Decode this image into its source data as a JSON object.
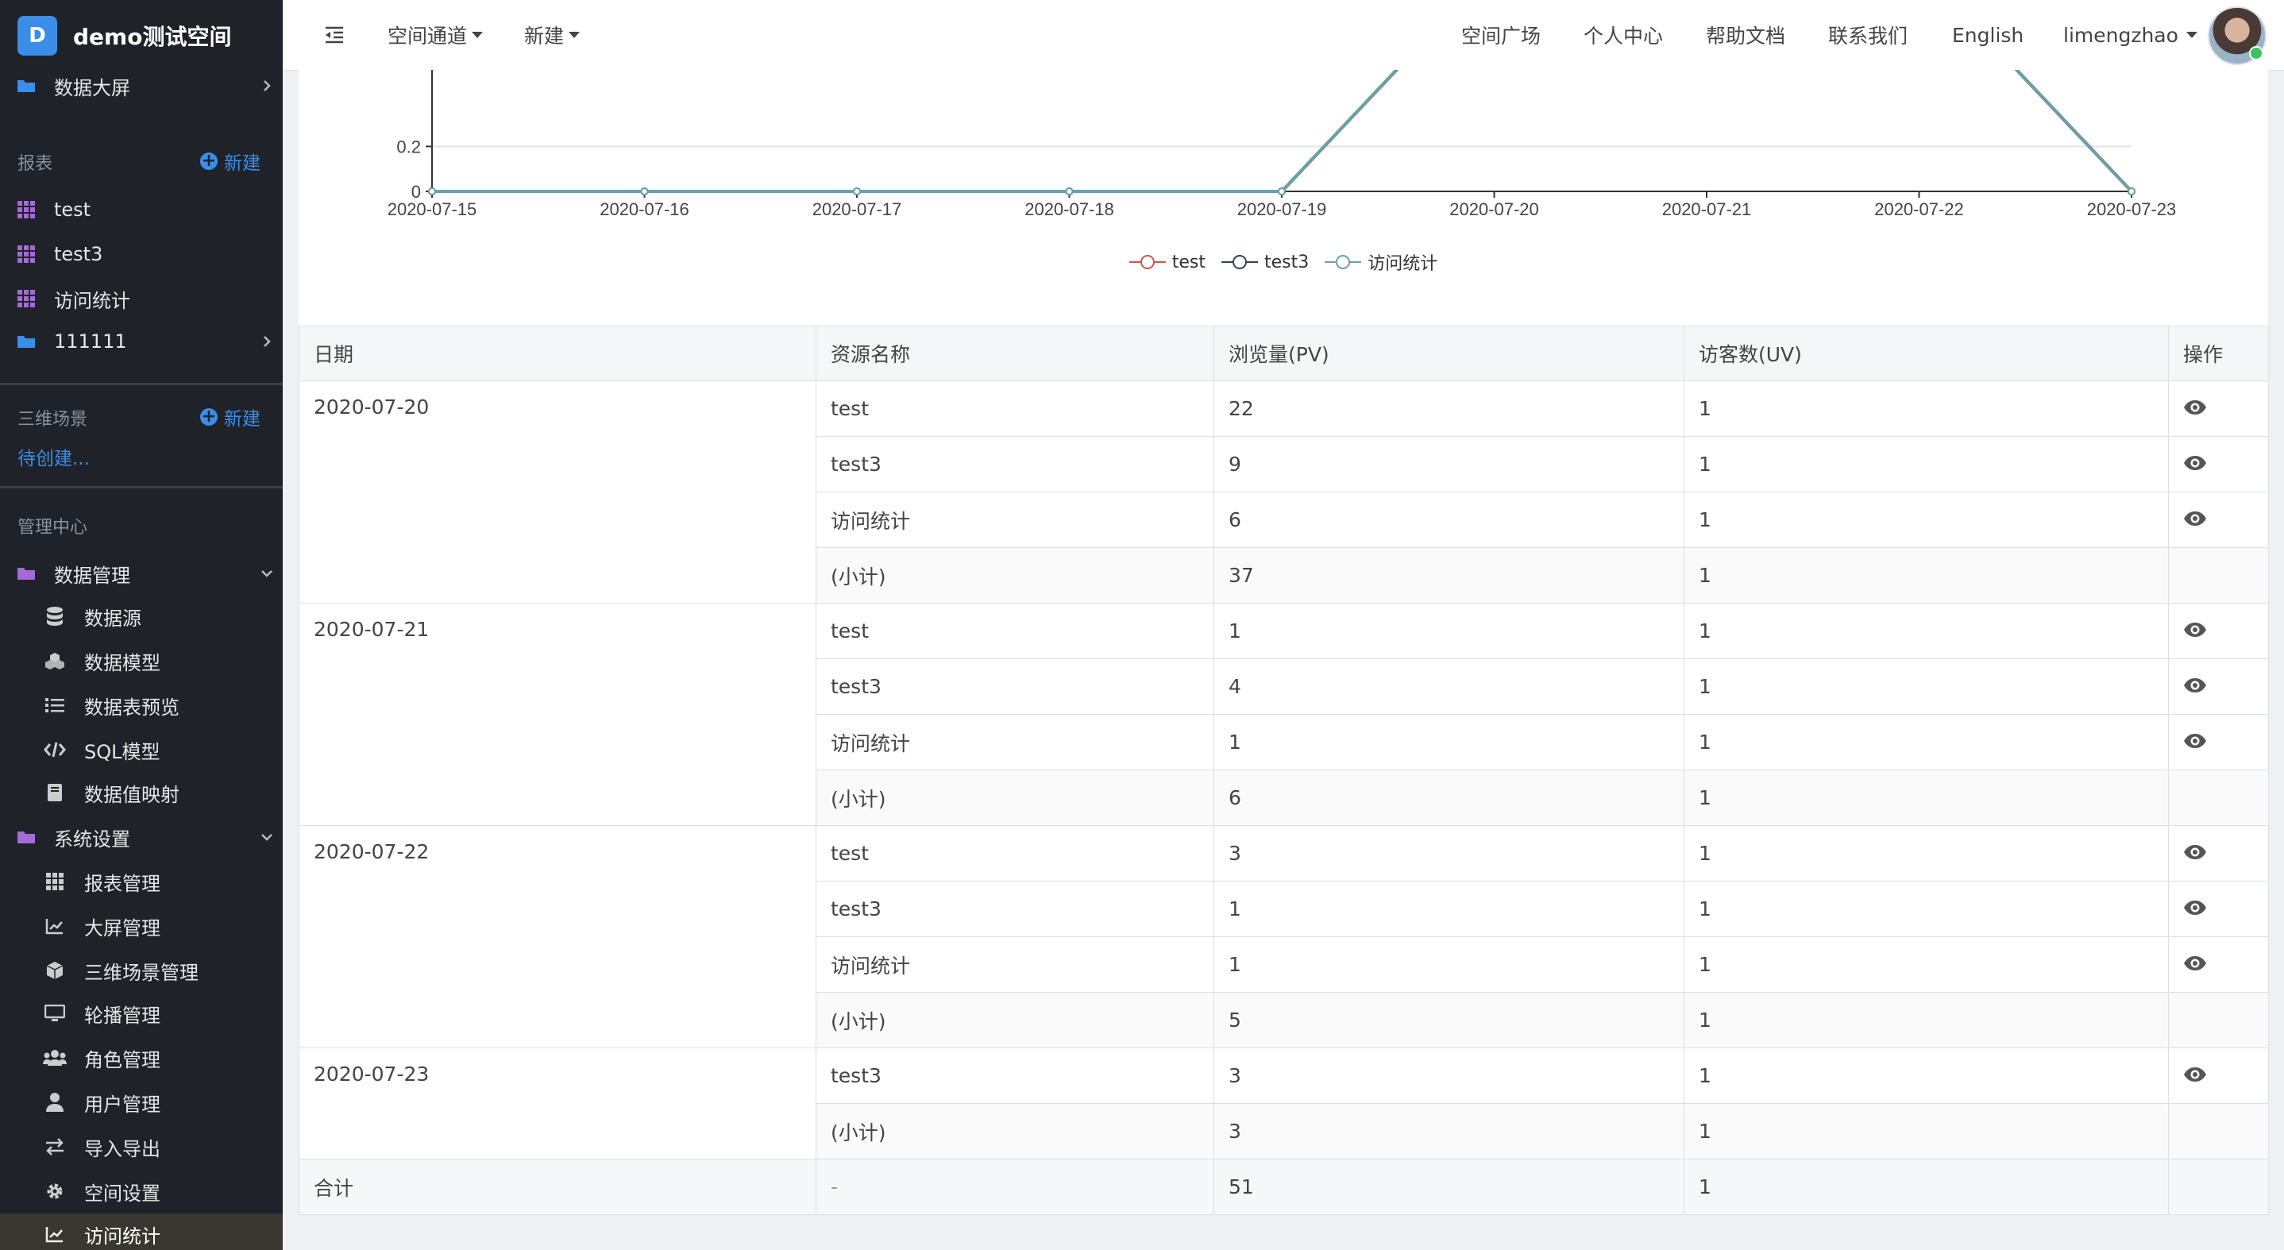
{
  "sidebar": {
    "brand_letter": "D",
    "brand_name": "demo测试空间",
    "top_item": "数据大屏",
    "reports": {
      "header": "报表",
      "new_label": "新建",
      "items": [
        "test",
        "test3",
        "访问统计"
      ],
      "folder": "111111"
    },
    "scenes": {
      "header": "三维场景",
      "new_label": "新建",
      "pending": "待创建..."
    },
    "admin": {
      "header": "管理中心",
      "data_mgmt": "数据管理",
      "data_items": [
        "数据源",
        "数据模型",
        "数据表预览",
        "SQL模型",
        "数据值映射"
      ],
      "sys_settings": "系统设置",
      "sys_items": [
        "报表管理",
        "大屏管理",
        "三维场景管理",
        "轮播管理",
        "角色管理",
        "用户管理",
        "导入导出",
        "空间设置",
        "访问统计"
      ]
    }
  },
  "topbar": {
    "space_channel": "空间通道",
    "new_menu": "新建",
    "links": [
      "空间广场",
      "个人中心",
      "帮助文档",
      "联系我们",
      "English"
    ],
    "username": "limengzhao"
  },
  "chart_data": {
    "type": "line",
    "categories": [
      "2020-07-15",
      "2020-07-16",
      "2020-07-17",
      "2020-07-18",
      "2020-07-19",
      "2020-07-20",
      "2020-07-21",
      "2020-07-22",
      "2020-07-23"
    ],
    "y_ticks": [
      "0",
      "0.2"
    ],
    "series": [
      {
        "name": "test",
        "color": "#c9574e",
        "values": [
          0,
          0,
          0,
          0,
          0,
          1,
          1,
          1,
          0
        ]
      },
      {
        "name": "test3",
        "color": "#2f4552",
        "values": [
          0,
          0,
          0,
          0,
          0,
          1,
          1,
          1,
          0
        ]
      },
      {
        "name": "访问统计",
        "color": "#6aa0a8",
        "values": [
          0,
          0,
          0,
          0,
          0,
          1,
          1,
          1,
          0
        ]
      }
    ]
  },
  "table": {
    "headers": [
      "日期",
      "资源名称",
      "浏览量(PV)",
      "访客数(UV)",
      "操作"
    ],
    "groups": [
      {
        "date": "2020-07-20",
        "rows": [
          {
            "name": "test",
            "pv": "22",
            "uv": "1",
            "view": true
          },
          {
            "name": "test3",
            "pv": "9",
            "uv": "1",
            "view": true
          },
          {
            "name": "访问统计",
            "pv": "6",
            "uv": "1",
            "view": true
          },
          {
            "name": "(小计)",
            "pv": "37",
            "uv": "1",
            "view": false
          }
        ]
      },
      {
        "date": "2020-07-21",
        "rows": [
          {
            "name": "test",
            "pv": "1",
            "uv": "1",
            "view": true
          },
          {
            "name": "test3",
            "pv": "4",
            "uv": "1",
            "view": true
          },
          {
            "name": "访问统计",
            "pv": "1",
            "uv": "1",
            "view": true
          },
          {
            "name": "(小计)",
            "pv": "6",
            "uv": "1",
            "view": false
          }
        ]
      },
      {
        "date": "2020-07-22",
        "rows": [
          {
            "name": "test",
            "pv": "3",
            "uv": "1",
            "view": true
          },
          {
            "name": "test3",
            "pv": "1",
            "uv": "1",
            "view": true
          },
          {
            "name": "访问统计",
            "pv": "1",
            "uv": "1",
            "view": true
          },
          {
            "name": "(小计)",
            "pv": "5",
            "uv": "1",
            "view": false
          }
        ]
      },
      {
        "date": "2020-07-23",
        "rows": [
          {
            "name": "test3",
            "pv": "3",
            "uv": "1",
            "view": true
          },
          {
            "name": "(小计)",
            "pv": "3",
            "uv": "1",
            "view": false
          }
        ]
      }
    ],
    "total": {
      "label": "合计",
      "name": "-",
      "pv": "51",
      "uv": "1"
    }
  },
  "colors": {
    "accent": "#3b8ee8",
    "sidebar_bg": "#1f2229",
    "folder_purple": "#a46bd6",
    "report_grid": "#a46bd6",
    "online": "#3cc35a"
  }
}
